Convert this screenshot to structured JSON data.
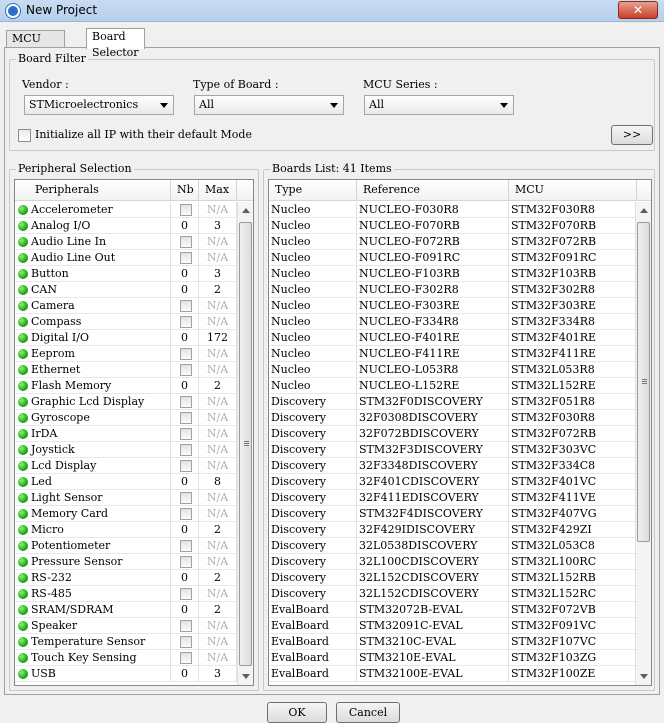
{
  "window": {
    "title": "New Project",
    "close_label": "✕"
  },
  "tabs": [
    {
      "label": "MCU Selector"
    },
    {
      "label": "Board Selector"
    }
  ],
  "board_filter": {
    "group_label": "Board Filter",
    "vendor": {
      "label": "Vendor :",
      "value": "STMicroelectronics"
    },
    "type_of_board": {
      "label": "Type of Board :",
      "value": "All"
    },
    "mcu_series": {
      "label": "MCU Series :",
      "value": "All"
    },
    "init_ip": {
      "label": "Initialize all IP with their default Mode",
      "checked": false
    },
    "more_button": ">>"
  },
  "peripherals": {
    "group_label": "Peripheral Selection",
    "columns": [
      "Peripherals",
      "Nb",
      "Max"
    ],
    "rows": [
      {
        "name": "Accelerometer",
        "nb": "",
        "max": "N/A"
      },
      {
        "name": "Analog I/O",
        "nb": "0",
        "max": "3"
      },
      {
        "name": "Audio Line In",
        "nb": "",
        "max": "N/A"
      },
      {
        "name": "Audio Line Out",
        "nb": "",
        "max": "N/A"
      },
      {
        "name": "Button",
        "nb": "0",
        "max": "3"
      },
      {
        "name": "CAN",
        "nb": "0",
        "max": "2"
      },
      {
        "name": "Camera",
        "nb": "",
        "max": "N/A"
      },
      {
        "name": "Compass",
        "nb": "",
        "max": "N/A"
      },
      {
        "name": "Digital I/O",
        "nb": "0",
        "max": "172"
      },
      {
        "name": "Eeprom",
        "nb": "",
        "max": "N/A"
      },
      {
        "name": "Ethernet",
        "nb": "",
        "max": "N/A"
      },
      {
        "name": "Flash Memory",
        "nb": "0",
        "max": "2"
      },
      {
        "name": "Graphic Lcd Display",
        "nb": "",
        "max": "N/A"
      },
      {
        "name": "Gyroscope",
        "nb": "",
        "max": "N/A"
      },
      {
        "name": "IrDA",
        "nb": "",
        "max": "N/A"
      },
      {
        "name": "Joystick",
        "nb": "",
        "max": "N/A"
      },
      {
        "name": "Lcd Display",
        "nb": "",
        "max": "N/A"
      },
      {
        "name": "Led",
        "nb": "0",
        "max": "8"
      },
      {
        "name": "Light Sensor",
        "nb": "",
        "max": "N/A"
      },
      {
        "name": "Memory Card",
        "nb": "",
        "max": "N/A"
      },
      {
        "name": "Micro",
        "nb": "0",
        "max": "2"
      },
      {
        "name": "Potentiometer",
        "nb": "",
        "max": "N/A"
      },
      {
        "name": "Pressure Sensor",
        "nb": "",
        "max": "N/A"
      },
      {
        "name": "RS-232",
        "nb": "0",
        "max": "2"
      },
      {
        "name": "RS-485",
        "nb": "",
        "max": "N/A"
      },
      {
        "name": "SRAM/SDRAM",
        "nb": "0",
        "max": "2"
      },
      {
        "name": "Speaker",
        "nb": "",
        "max": "N/A"
      },
      {
        "name": "Temperature Sensor",
        "nb": "",
        "max": "N/A"
      },
      {
        "name": "Touch Key Sensing",
        "nb": "",
        "max": "N/A"
      },
      {
        "name": "USB",
        "nb": "0",
        "max": "3"
      }
    ]
  },
  "boards": {
    "group_label": "Boards List: 41 Items",
    "columns": [
      "Type",
      "Reference",
      "MCU"
    ],
    "rows": [
      {
        "type": "Nucleo",
        "reference": "NUCLEO-F030R8",
        "mcu": "STM32F030R8"
      },
      {
        "type": "Nucleo",
        "reference": "NUCLEO-F070RB",
        "mcu": "STM32F070RB"
      },
      {
        "type": "Nucleo",
        "reference": "NUCLEO-F072RB",
        "mcu": "STM32F072RB"
      },
      {
        "type": "Nucleo",
        "reference": "NUCLEO-F091RC",
        "mcu": "STM32F091RC"
      },
      {
        "type": "Nucleo",
        "reference": "NUCLEO-F103RB",
        "mcu": "STM32F103RB"
      },
      {
        "type": "Nucleo",
        "reference": "NUCLEO-F302R8",
        "mcu": "STM32F302R8"
      },
      {
        "type": "Nucleo",
        "reference": "NUCLEO-F303RE",
        "mcu": "STM32F303RE"
      },
      {
        "type": "Nucleo",
        "reference": "NUCLEO-F334R8",
        "mcu": "STM32F334R8"
      },
      {
        "type": "Nucleo",
        "reference": "NUCLEO-F401RE",
        "mcu": "STM32F401RE"
      },
      {
        "type": "Nucleo",
        "reference": "NUCLEO-F411RE",
        "mcu": "STM32F411RE"
      },
      {
        "type": "Nucleo",
        "reference": "NUCLEO-L053R8",
        "mcu": "STM32L053R8"
      },
      {
        "type": "Nucleo",
        "reference": "NUCLEO-L152RE",
        "mcu": "STM32L152RE"
      },
      {
        "type": "Discovery",
        "reference": "STM32F0DISCOVERY",
        "mcu": "STM32F051R8"
      },
      {
        "type": "Discovery",
        "reference": "32F0308DISCOVERY",
        "mcu": "STM32F030R8"
      },
      {
        "type": "Discovery",
        "reference": "32F072BDISCOVERY",
        "mcu": "STM32F072RB"
      },
      {
        "type": "Discovery",
        "reference": "STM32F3DISCOVERY",
        "mcu": "STM32F303VC"
      },
      {
        "type": "Discovery",
        "reference": "32F3348DISCOVERY",
        "mcu": "STM32F334C8"
      },
      {
        "type": "Discovery",
        "reference": "32F401CDISCOVERY",
        "mcu": "STM32F401VC"
      },
      {
        "type": "Discovery",
        "reference": "32F411EDISCOVERY",
        "mcu": "STM32F411VE"
      },
      {
        "type": "Discovery",
        "reference": "STM32F4DISCOVERY",
        "mcu": "STM32F407VG"
      },
      {
        "type": "Discovery",
        "reference": "32F429IDISCOVERY",
        "mcu": "STM32F429ZI"
      },
      {
        "type": "Discovery",
        "reference": "32L0538DISCOVERY",
        "mcu": "STM32L053C8"
      },
      {
        "type": "Discovery",
        "reference": "32L100CDISCOVERY",
        "mcu": "STM32L100RC"
      },
      {
        "type": "Discovery",
        "reference": "32L152CDISCOVERY",
        "mcu": "STM32L152RB"
      },
      {
        "type": "Discovery",
        "reference": "32L152CDISCOVERY",
        "mcu": "STM32L152RC"
      },
      {
        "type": "EvalBoard",
        "reference": "STM32072B-EVAL",
        "mcu": "STM32F072VB"
      },
      {
        "type": "EvalBoard",
        "reference": "STM32091C-EVAL",
        "mcu": "STM32F091VC"
      },
      {
        "type": "EvalBoard",
        "reference": "STM3210C-EVAL",
        "mcu": "STM32F107VC"
      },
      {
        "type": "EvalBoard",
        "reference": "STM3210E-EVAL",
        "mcu": "STM32F103ZG"
      },
      {
        "type": "EvalBoard",
        "reference": "STM32100E-EVAL",
        "mcu": "STM32F100ZE"
      }
    ]
  },
  "footer": {
    "ok_label": "OK",
    "cancel_label": "Cancel"
  }
}
